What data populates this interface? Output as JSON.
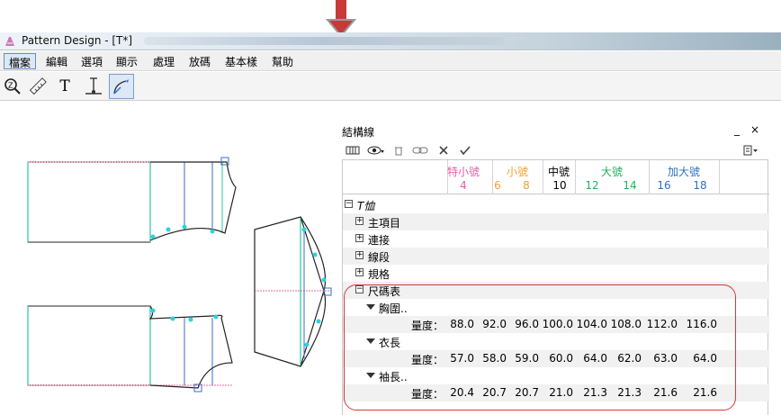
{
  "window": {
    "title": "Pattern Design - [T*]"
  },
  "menu": [
    "檔案",
    "編輯",
    "選項",
    "顯示",
    "處理",
    "放碼",
    "基本樣",
    "幫助"
  ],
  "toolbar": {
    "tools": [
      "zoom-tool",
      "measure-tool",
      "text-tool",
      "point-tool",
      "curve-tool"
    ],
    "text_label": "T"
  },
  "panel": {
    "title": "結構線",
    "minimize": "_",
    "close": "×"
  },
  "sizes": {
    "groups": [
      {
        "label": "特小號",
        "color": "#e060a8",
        "numbers": [
          "4"
        ]
      },
      {
        "label": "小號",
        "color": "#f0a030",
        "numbers": [
          "6",
          "8"
        ]
      },
      {
        "label": "中號",
        "color": "#000000",
        "numbers": [
          "10"
        ]
      },
      {
        "label": "大號",
        "color": "#20b060",
        "numbers": [
          "12",
          "14"
        ]
      },
      {
        "label": "加大號",
        "color": "#3070c0",
        "numbers": [
          "16",
          "18"
        ]
      }
    ]
  },
  "tree": {
    "root": "T恤",
    "nodes": [
      "主項目",
      "連接",
      "線段",
      "規格",
      "尺碼表"
    ],
    "measurements": [
      {
        "name": "胸圍..",
        "label": "量度：",
        "values": [
          "88.0",
          "92.0",
          "96.0",
          "100.0",
          "104.0",
          "108.0",
          "112.0",
          "116.0"
        ]
      },
      {
        "name": "衣長",
        "label": "量度：",
        "values": [
          "57.0",
          "58.0",
          "59.0",
          "60.0",
          "64.0",
          "62.0",
          "63.0",
          "64.0"
        ]
      },
      {
        "name": "袖長..",
        "label": "量度：",
        "values": [
          "20.4",
          "20.7",
          "20.7",
          "21.0",
          "21.3",
          "21.3",
          "21.6",
          "21.6"
        ]
      }
    ]
  },
  "colors": {
    "accent": "#6b8db5",
    "highlight": "#d23a3a",
    "pattern_outline": "#222222",
    "pattern_pink": "#e86a9a",
    "pattern_green": "#30c0a0",
    "pattern_blue": "#3a6ec8",
    "pattern_point": "#29d3e0"
  }
}
